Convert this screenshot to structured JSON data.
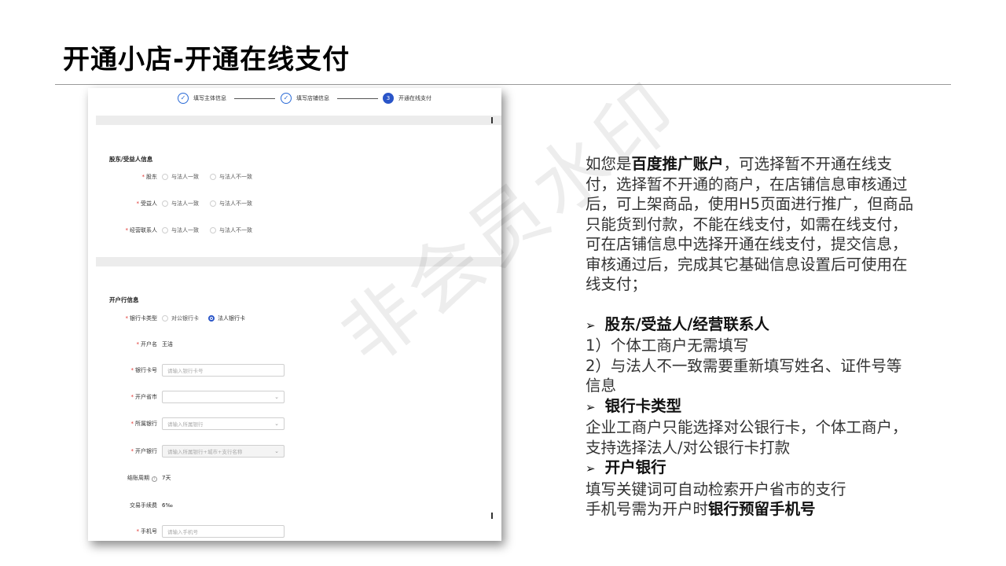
{
  "title": "开通小店-开通在线支付",
  "watermark": "非会员水印",
  "form": {
    "steps": [
      {
        "label": "填写主体信息",
        "state": "done"
      },
      {
        "label": "填写店铺信息",
        "state": "done"
      },
      {
        "label": "开通在线支付",
        "state": "active",
        "number": "3"
      }
    ],
    "check_glyph": "✓",
    "shareholder_section": {
      "title": "股东/受益人信息",
      "rows": [
        {
          "label": "股东",
          "options": [
            "与法人一致",
            "与法人不一致"
          ]
        },
        {
          "label": "受益人",
          "options": [
            "与法人一致",
            "与法人不一致"
          ]
        },
        {
          "label": "经营联系人",
          "options": [
            "与法人一致",
            "与法人不一致"
          ]
        }
      ]
    },
    "bank_section": {
      "title": "开户行信息",
      "card_type_label": "银行卡类型",
      "card_type_options": [
        "对公银行卡",
        "法人银行卡"
      ],
      "card_type_selected": "法人银行卡",
      "account_name_label": "开户名",
      "account_name_value": "王洁",
      "card_number_label": "银行卡号",
      "card_number_placeholder": "请输入银行卡号",
      "province_label": "开户省市",
      "bank_label": "所属银行",
      "bank_placeholder": "请输入所属银行",
      "branch_label": "开户银行",
      "branch_placeholder": "请输入所属银行+城市+支行名称",
      "settle_label": "结账周期",
      "settle_value": "7天",
      "fee_label": "交易手续费",
      "fee_value": "6‰",
      "phone_label": "手机号",
      "phone_placeholder": "请输入手机号"
    },
    "required_mark": "*",
    "chevron": "⌄",
    "info_glyph": "i"
  },
  "notes": {
    "para1_a": "如您是",
    "para1_bold": "百度推广账户",
    "para1_b": "，可选择暂不开通在线支付，选择暂不开通的商户，在店铺信息审核通过后，可上架商品，使用H5页面进行推广，但商品只能货到付款，不能在线支付，如需在线支付，可在店铺信息中选择开通在线支付，提交信息，审核通过后，完成其它基础信息设置后可使用在线支付；",
    "bullet_marker": "➢",
    "h1": "股东/受益人/经营联系人",
    "h1_lines": [
      "1）个体工商户无需填写",
      "2）与法人不一致需要重新填写姓名、证件号等信息"
    ],
    "h2": "银行卡类型",
    "h2_text": "企业工商户只能选择对公银行卡，个体工商户，支持选择法人/对公银行卡打款",
    "h3": "开户银行",
    "h3_line1": "填写关键词可自动检索开户省市的支行",
    "h3_line2_a": "手机号需为开户时",
    "h3_line2_bold": "银行预留手机号"
  }
}
